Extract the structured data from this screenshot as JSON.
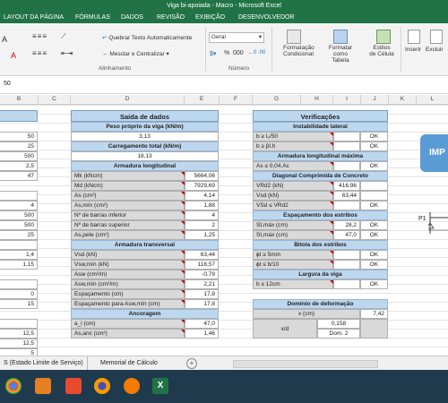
{
  "window": {
    "title": "Viga bi-apoiada - Macro - Microsoft Excel"
  },
  "ribbon_tabs": [
    "LAYOUT DA PÁGINA",
    "FÓRMULAS",
    "DADOS",
    "REVISÃO",
    "EXIBIÇÃO",
    "DESENVOLVEDOR"
  ],
  "ribbon": {
    "wrap_text": "Quebrar Texto Automaticamente",
    "merge_center": "Mesclar e Centralizar",
    "alignment_group": "Alinhamento",
    "number_format": "Geral",
    "number_group": "Número",
    "conditional_format": "Formatação Condicional",
    "format_table": "Formatar como Tabela",
    "cell_styles": "Estilos de Célula",
    "insert": "Inserir",
    "delete": "Excluir",
    "percent_symbol": "%",
    "thousands_symbol": "000"
  },
  "formula_bar": {
    "value": "50"
  },
  "columns": [
    "B",
    "C",
    "D",
    "E",
    "F",
    "G",
    "H",
    "I",
    "J",
    "K",
    "L"
  ],
  "left_values": [
    "50",
    "25",
    "500",
    "2,5",
    "47",
    "",
    "4",
    "500",
    "500",
    "25",
    "",
    "1,4",
    "1,15",
    "",
    "0",
    "15",
    "",
    "12,5",
    "12,5",
    "5"
  ],
  "saida": {
    "title": "Saída de dados",
    "peso_label": "Peso próprio da viga (kN/m)",
    "peso_value": "3,13",
    "carreg_label": "Carregamento total (kN/m)",
    "carreg_value": "18,13",
    "arm_long_label": "Armadura longitudinal",
    "arm_long_rows": [
      {
        "label": "Mk (kNcm)",
        "value": "5664,06"
      },
      {
        "label": "Md (kNcm)",
        "value": "7929,69"
      },
      {
        "label": "As (cm²)",
        "value": "4,14"
      },
      {
        "label": "As,mín (cm²)",
        "value": "1,88"
      },
      {
        "label": "Nº de barras inferior",
        "value": "4"
      },
      {
        "label": "Nº de barras superior",
        "value": "2"
      },
      {
        "label": "As,pele (cm²)",
        "value": "1,25"
      }
    ],
    "arm_transv_label": "Armadura transversal",
    "arm_transv_rows": [
      {
        "label": "Vsd (kN)",
        "value": "63,44"
      },
      {
        "label": "Vsw,mín (kN)",
        "value": "118,57"
      },
      {
        "label": "Asw (cm²/m)",
        "value": "-0,79"
      },
      {
        "label": "Asw,mín (cm²/m)",
        "value": "2,21"
      },
      {
        "label": "Espaçamento (cm)",
        "value": "17,8"
      },
      {
        "label": "Espaçamento para Asw,mín (cm)",
        "value": "17,8"
      }
    ],
    "ancoragem_label": "Ancoragem",
    "ancoragem_rows": [
      {
        "label": "a_l (cm)",
        "value": "47,0"
      },
      {
        "label": "As,anc (cm²)",
        "value": "1,46"
      }
    ]
  },
  "verif": {
    "title": "Verificações",
    "instab_label": "Instabilidade lateral",
    "instab_rows": [
      {
        "label": "b ≥ l₀/50",
        "value": "",
        "status": "OK"
      },
      {
        "label": "b ≥ βl.h",
        "value": "",
        "status": "OK"
      }
    ],
    "arm_max_label": "Armadura longitudinal máxima",
    "arm_max_rows": [
      {
        "label": "As ≤ 0,04.Ac",
        "value": "",
        "status": "OK"
      }
    ],
    "diag_label": "Diagonal Comprimida de Concreto",
    "diag_rows": [
      {
        "label": "VRd2 (kN)",
        "value": "416,96",
        "status": ""
      },
      {
        "label": "Vsd (kN)",
        "value": "63,44",
        "status": ""
      },
      {
        "label": "VSd ≤ VRd2",
        "value": "",
        "status": "OK"
      }
    ],
    "esp_label": "Espaçamento dos estribos",
    "esp_rows": [
      {
        "label": "St,máx (cm)",
        "value": "28,2",
        "status": "OK"
      },
      {
        "label": "St,máx (cm)",
        "value": "47,0",
        "status": "OK"
      }
    ],
    "bitola_label": "Bitola dos estribos",
    "bitola_rows": [
      {
        "label": "ϕt ≥ 5mm",
        "value": "",
        "status": "OK"
      },
      {
        "label": "ϕt ≤ b/10",
        "value": "",
        "status": "OK"
      }
    ],
    "largura_label": "Largura da viga",
    "largura_rows": [
      {
        "label": "b ≥ 12cm",
        "value": "",
        "status": "OK"
      }
    ],
    "dominio_label": "Domínio de deformação",
    "x_label": "x (cm)",
    "x_value": "7,42",
    "xd_label": "x/d",
    "xd_value": "0,158",
    "dom_value": "Dom. 2"
  },
  "right_box": {
    "text": "IMP"
  },
  "p1_label": "P1",
  "sheet_tabs": [
    "S (Estado Limite de Serviço)",
    "Memorial de Cálculo"
  ],
  "add_sheet": "+",
  "colors": {
    "excel_green": "#217346",
    "header_blue": "#bdd7ee",
    "label_gray": "#d9d9d9"
  }
}
